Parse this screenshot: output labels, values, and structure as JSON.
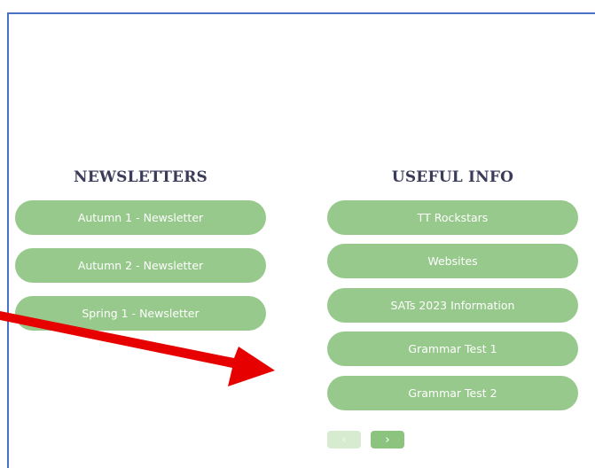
{
  "newsletters": {
    "heading": "NEWSLETTERS",
    "items": [
      {
        "label": "Autumn 1 - Newsletter"
      },
      {
        "label": "Autumn 2 - Newsletter"
      },
      {
        "label": "Spring 1 - Newsletter"
      }
    ]
  },
  "useful_info": {
    "heading": "USEFUL INFO",
    "items": [
      {
        "label": "TT Rockstars"
      },
      {
        "label": "Websites"
      },
      {
        "label": "SATs 2023 Information"
      },
      {
        "label": "Grammar Test 1"
      },
      {
        "label": "Grammar Test 2"
      }
    ]
  },
  "carousel": {
    "prev_icon": "chevron-left-icon",
    "next_icon": "chevron-right-icon",
    "prev_glyph": "‹",
    "next_glyph": "›"
  },
  "colors": {
    "button_green": "#96c98b",
    "heading_text": "#3b3b5a",
    "frame_border": "#4a72c4",
    "annotation_arrow": "#e60000"
  }
}
